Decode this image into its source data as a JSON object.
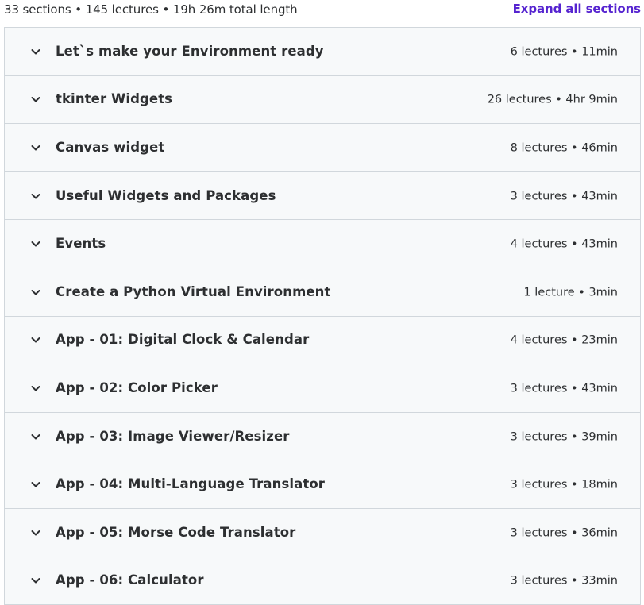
{
  "summary": {
    "text": "33 sections • 145 lectures • 19h 26m total length",
    "expand_label": "Expand all sections"
  },
  "colors": {
    "accent": "#5624d0",
    "text": "#2d2f31",
    "section_bg": "#f7f9fa",
    "border": "#d1d7dc"
  },
  "sections": [
    {
      "title": "Let`s make your Environment ready",
      "meta": "6 lectures • 11min",
      "icon": "chevron-down-icon"
    },
    {
      "title": "tkinter Widgets",
      "meta": "26 lectures • 4hr 9min",
      "icon": "chevron-down-icon"
    },
    {
      "title": "Canvas widget",
      "meta": "8 lectures • 46min",
      "icon": "chevron-down-icon"
    },
    {
      "title": "Useful Widgets and Packages",
      "meta": "3 lectures • 43min",
      "icon": "chevron-down-icon"
    },
    {
      "title": "Events",
      "meta": "4 lectures • 43min",
      "icon": "chevron-down-icon"
    },
    {
      "title": "Create a Python Virtual Environment",
      "meta": "1 lecture • 3min",
      "icon": "chevron-down-icon"
    },
    {
      "title": "App - 01: Digital Clock & Calendar",
      "meta": "4 lectures • 23min",
      "icon": "chevron-down-icon"
    },
    {
      "title": "App - 02: Color Picker",
      "meta": "3 lectures • 43min",
      "icon": "chevron-down-icon"
    },
    {
      "title": "App - 03: Image Viewer/Resizer",
      "meta": "3 lectures • 39min",
      "icon": "chevron-down-icon"
    },
    {
      "title": "App - 04: Multi-Language Translator",
      "meta": "3 lectures • 18min",
      "icon": "chevron-down-icon"
    },
    {
      "title": "App - 05: Morse Code Translator",
      "meta": "3 lectures • 36min",
      "icon": "chevron-down-icon"
    },
    {
      "title": "App - 06: Calculator",
      "meta": "3 lectures • 33min",
      "icon": "chevron-down-icon"
    }
  ]
}
